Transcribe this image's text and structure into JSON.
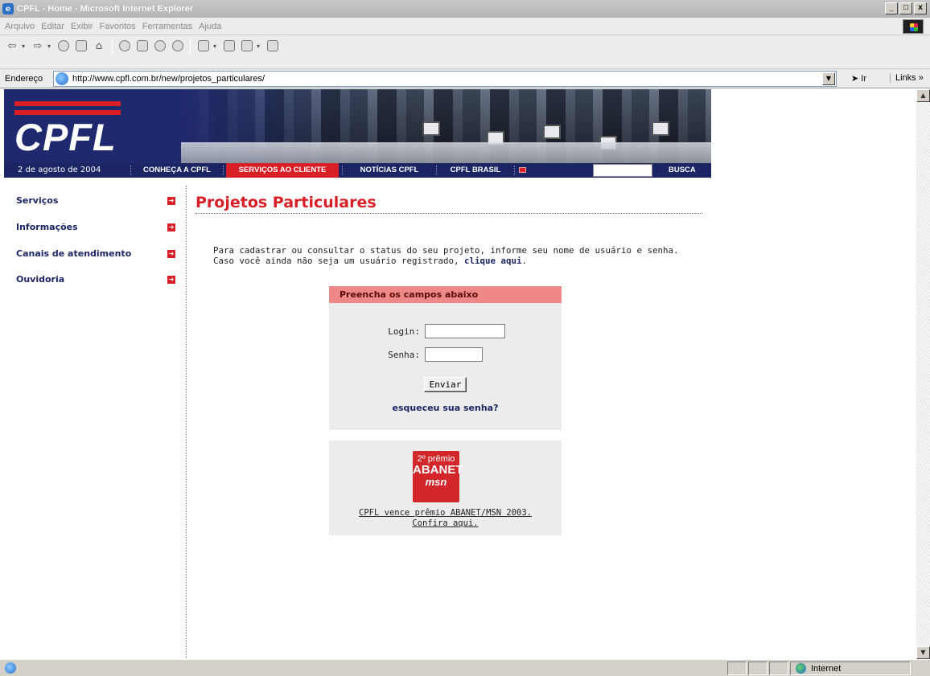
{
  "window": {
    "title": "CPFL - Home - Microsoft Internet Explorer",
    "controls": [
      "_",
      "□",
      "x"
    ]
  },
  "menubar": [
    "Arquivo",
    "Editar",
    "Exibir",
    "Favoritos",
    "Ferramentas",
    "Ajuda"
  ],
  "addressbar": {
    "label": "Endereço",
    "url": "http://www.cpfl.com.br/new/projetos_particulares/",
    "go_label": "Ir",
    "links_label": "Links »"
  },
  "site": {
    "logo": "CPFL",
    "date": "2 de agosto de 2004",
    "nav": [
      "CONHEÇA A CPFL",
      "SERVIÇOS AO CLIENTE",
      "NOTÍCIAS CPFL",
      "CPFL BRASIL"
    ],
    "active_nav": "SERVIÇOS AO CLIENTE",
    "search_button": "BUSCA",
    "search_value": ""
  },
  "sidebar": [
    {
      "label": "Serviços"
    },
    {
      "label": "Informações"
    },
    {
      "label": "Canais de atendimento"
    },
    {
      "label": "Ouvidoria"
    }
  ],
  "main": {
    "title": "Projetos Particulares",
    "intro_line1": "Para cadastrar ou consultar o status do seu projeto, informe seu nome de usuário e senha.",
    "intro_line2_prefix": "Caso você ainda não seja um usuário registrado, ",
    "intro_line2_link": "clique aqui",
    "intro_line2_suffix": ".",
    "login": {
      "header": "Preencha os campos abaixo",
      "login_label": "Login:",
      "login_value": "",
      "password_label": "Senha:",
      "password_value": "",
      "submit_label": "Enviar",
      "forgot_label": "esqueceu sua senha?"
    },
    "award": {
      "badge_line1": "2º prêmio",
      "badge_line2": "ABANET",
      "badge_line3": "msn",
      "text_line1": "CPFL vence prêmio ABANET/MSN 2003.",
      "text_line2": "Confira aqui."
    }
  },
  "statusbar": {
    "zone": "Internet"
  },
  "colors": {
    "brand_red": "#d81f26",
    "brand_navy": "#1c2563",
    "login_header": "#ef8888"
  }
}
